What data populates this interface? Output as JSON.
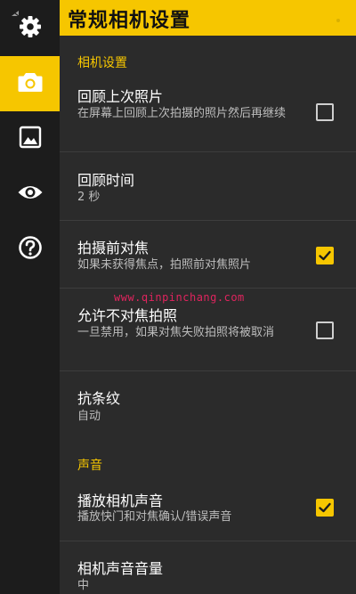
{
  "header": {
    "title": "常规相机设置"
  },
  "sidebar": {
    "items": [
      {
        "icon": "gear-icon",
        "active": false
      },
      {
        "icon": "camera-icon",
        "active": true
      },
      {
        "icon": "image-icon",
        "active": false
      },
      {
        "icon": "eye-icon",
        "active": false
      },
      {
        "icon": "help-icon",
        "active": false
      }
    ]
  },
  "colors": {
    "accent": "#f6c600",
    "sidebar_bg": "#1c1c1c",
    "content_bg": "#2b2b2b",
    "watermark": "#e0245e"
  },
  "sections": {
    "camera": {
      "label": "相机设置",
      "review_last": {
        "title": "回顾上次照片",
        "summary": "在屏幕上回顾上次拍摄的照片然后再继续",
        "checked": false
      },
      "review_time": {
        "title": "回顾时间",
        "value": "2 秒"
      },
      "focus_before": {
        "title": "拍摄前对焦",
        "summary": "如果未获得焦点，拍照前对焦照片",
        "checked": true
      },
      "allow_unfocused": {
        "title": "允许不对焦拍照",
        "summary": "一旦禁用，如果对焦失败拍照将被取消",
        "checked": false
      },
      "antibanding": {
        "title": "抗条纹",
        "value": "自动"
      }
    },
    "sound": {
      "label": "声音",
      "play_sound": {
        "title": "播放相机声音",
        "summary": "播放快门和对焦确认/错误声音",
        "checked": true
      },
      "sound_volume": {
        "title": "相机声音音量",
        "value": "中"
      }
    }
  },
  "watermark": {
    "text": "www.qinpinchang.com"
  }
}
